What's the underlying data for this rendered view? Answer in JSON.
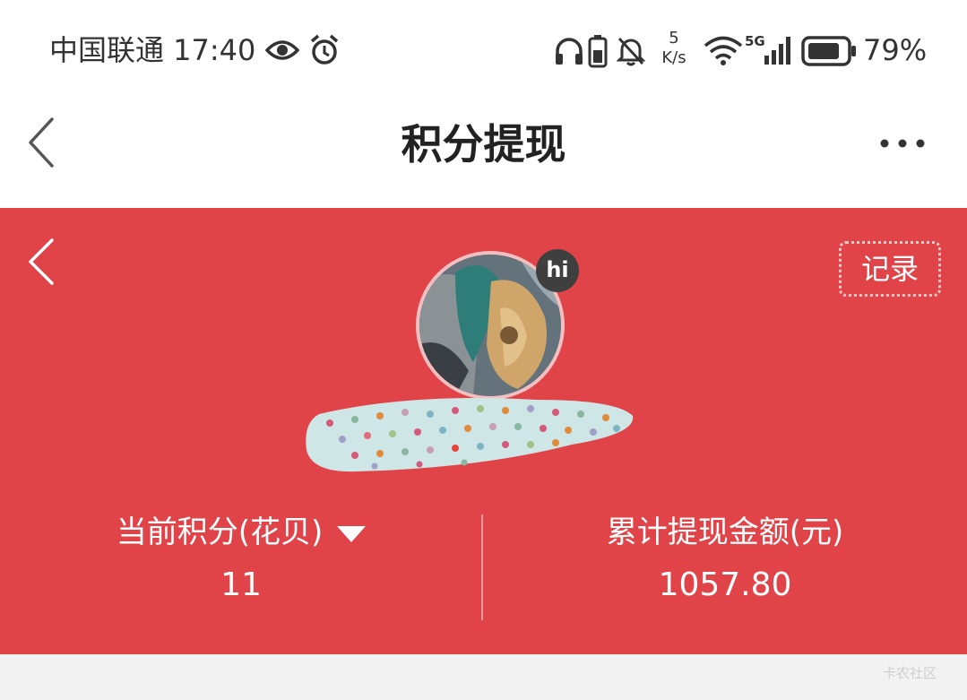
{
  "status_bar": {
    "carrier_time": "中国联通 17:40",
    "net_speed_value": "5",
    "net_speed_unit": "K/s",
    "network_type": "5G",
    "battery_percent": "79%",
    "icons": [
      "eye-icon",
      "alarm-icon",
      "headphones-icon",
      "battery-small-icon",
      "bell-muted-icon",
      "wifi-icon",
      "signal-icon",
      "battery-icon"
    ]
  },
  "nav": {
    "title": "积分提现",
    "back_icon": "chevron-left-icon",
    "more_icon": "more-dots-icon"
  },
  "header": {
    "records_label": "记录",
    "badge_label": "hi",
    "accent_color": "#e04448"
  },
  "stats": {
    "points_label": "当前积分(花贝)",
    "points_value": "11",
    "total_label": "累计提现金额(元)",
    "total_value": "1057.80"
  },
  "watermark": "卡农社区"
}
